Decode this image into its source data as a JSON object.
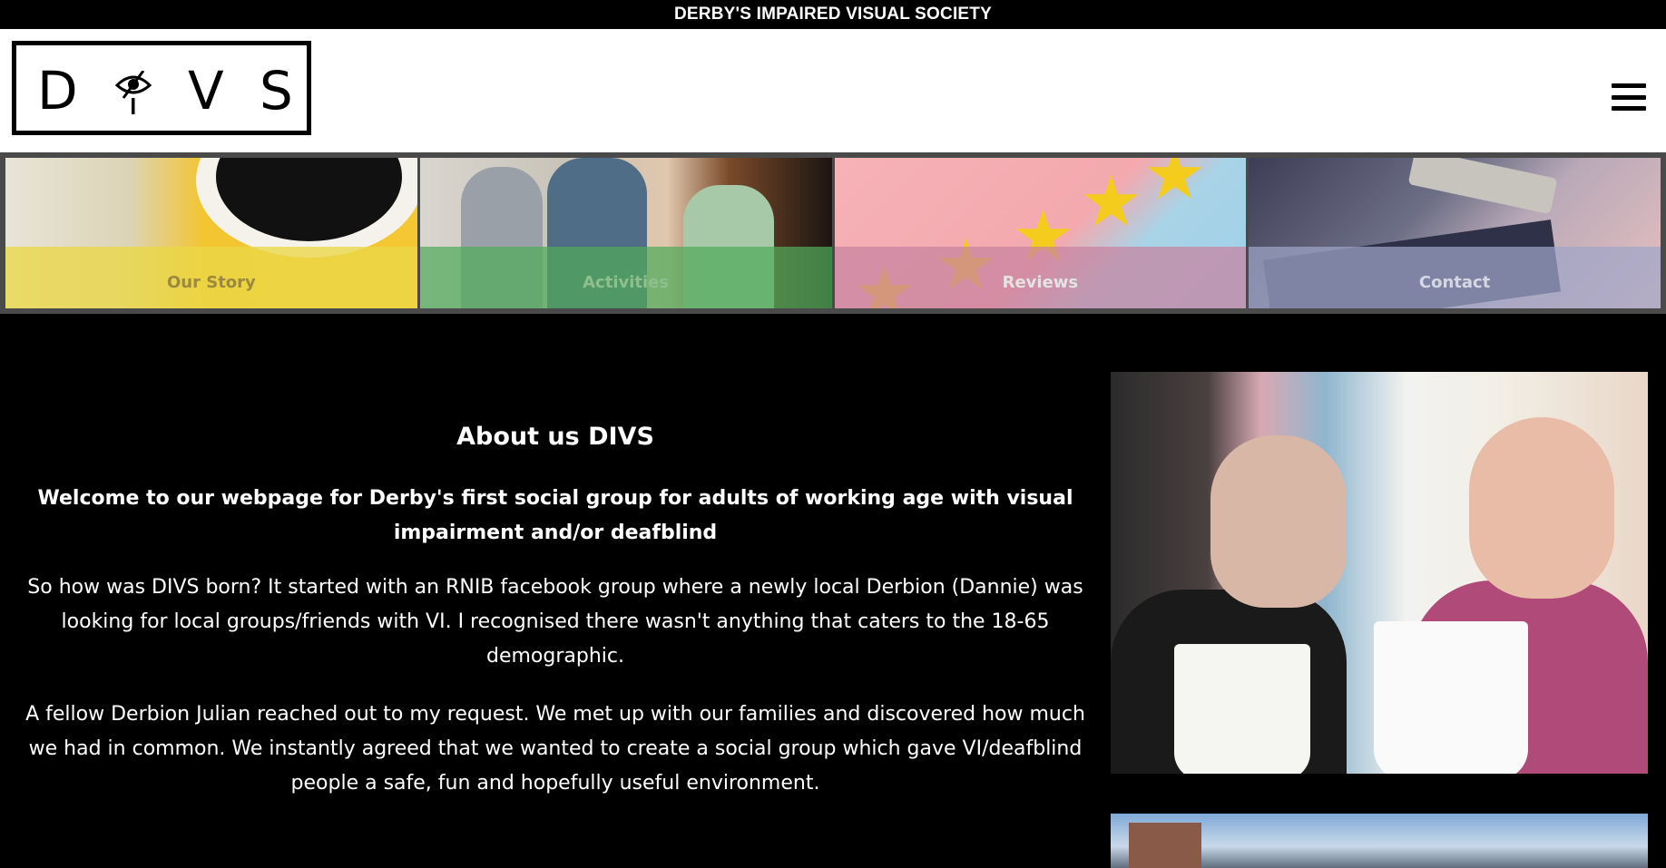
{
  "topbar": {
    "text": "DERBY'S IMPAIRED VISUAL SOCIETY"
  },
  "logo": {
    "letters": [
      "D",
      "V",
      "S"
    ],
    "eye_letter": "i"
  },
  "header": {
    "menu_icon": "hamburger-menu-icon"
  },
  "nav_tiles": [
    {
      "label": "Our Story"
    },
    {
      "label": "Activities"
    },
    {
      "label": "Reviews"
    },
    {
      "label": "Contact"
    }
  ],
  "about": {
    "heading": "About us DIVS",
    "lead": "Welcome to our webpage for Derby's first social group for adults of working age with visual impairment and/or deafblind",
    "paragraphs": [
      "So how was DIVS born? It started with an RNIB facebook group where a newly local Derbion (Dannie) was looking for local groups/friends with VI. I recognised there wasn't anything that caters to the 18-65 demographic.",
      "A fellow Derbion Julian reached out to my request. We met up with our families and discovered how much we had in common. We instantly agreed that we wanted to create a social group which gave VI/deafblind people a safe, fun and hopefully useful environment."
    ]
  },
  "colors": {
    "background": "#000000",
    "header_bg": "#ffffff",
    "tile_border": "#4a4a4a"
  }
}
